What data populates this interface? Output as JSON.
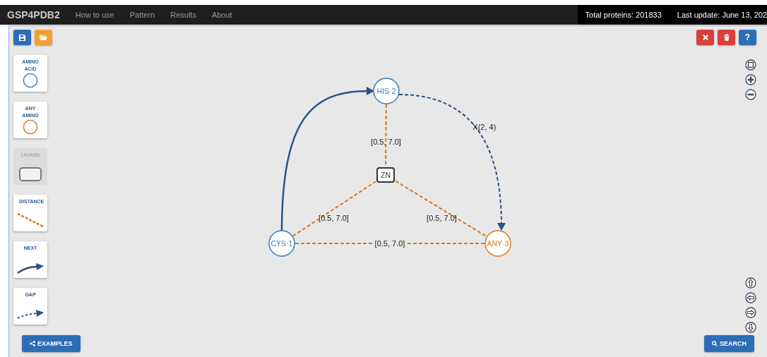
{
  "navbar": {
    "brand": "GSP4PDB2",
    "menu": [
      "How to use",
      "Pattern",
      "Results",
      "About"
    ],
    "stats": [
      "Total proteins: 201833",
      "Last update: June 13, 202"
    ]
  },
  "toolbar_left": [
    {
      "kind": "save"
    },
    {
      "kind": "open"
    }
  ],
  "toolbar_right": [
    {
      "kind": "clear"
    },
    {
      "kind": "delete"
    },
    {
      "kind": "help",
      "label": "?"
    }
  ],
  "palette": [
    {
      "kind": "amino",
      "label": "AMINO ACID",
      "disabled": false
    },
    {
      "kind": "any",
      "label": "ANY AMINO",
      "disabled": false
    },
    {
      "kind": "ligand",
      "label": "LIGAND",
      "disabled": true
    },
    {
      "kind": "distance",
      "label": "DISTANCE",
      "disabled": false
    },
    {
      "kind": "next",
      "label": "NEXT",
      "disabled": false
    },
    {
      "kind": "gap",
      "label": "GAP",
      "disabled": false
    }
  ],
  "graph": {
    "nodes": [
      {
        "kind": "amino",
        "label": "CYS·1"
      },
      {
        "kind": "amino",
        "label": "HIS·2"
      },
      {
        "kind": "any",
        "label": "ANY·3"
      },
      {
        "kind": "ligand",
        "label": "ZN"
      }
    ],
    "edges": [
      {
        "kind": "next"
      },
      {
        "kind": "gap",
        "label": "X(2, 4)"
      },
      {
        "kind": "distance",
        "label": "[0.5, 7.0]"
      },
      {
        "kind": "distance",
        "label": "[0.5, 7.0]"
      },
      {
        "kind": "distance",
        "label": "[0.5, 7.0]"
      },
      {
        "kind": "distance",
        "label": "[0.5, 7.0]"
      }
    ]
  },
  "view_controls": [
    {
      "kind": "fit"
    },
    {
      "kind": "zoom-in"
    },
    {
      "kind": "zoom-out"
    }
  ],
  "pan_controls": [
    {
      "kind": "up"
    },
    {
      "kind": "left"
    },
    {
      "kind": "right"
    },
    {
      "kind": "down"
    }
  ],
  "examples_button": "EXAMPLES",
  "search_button": "SEARCH"
}
